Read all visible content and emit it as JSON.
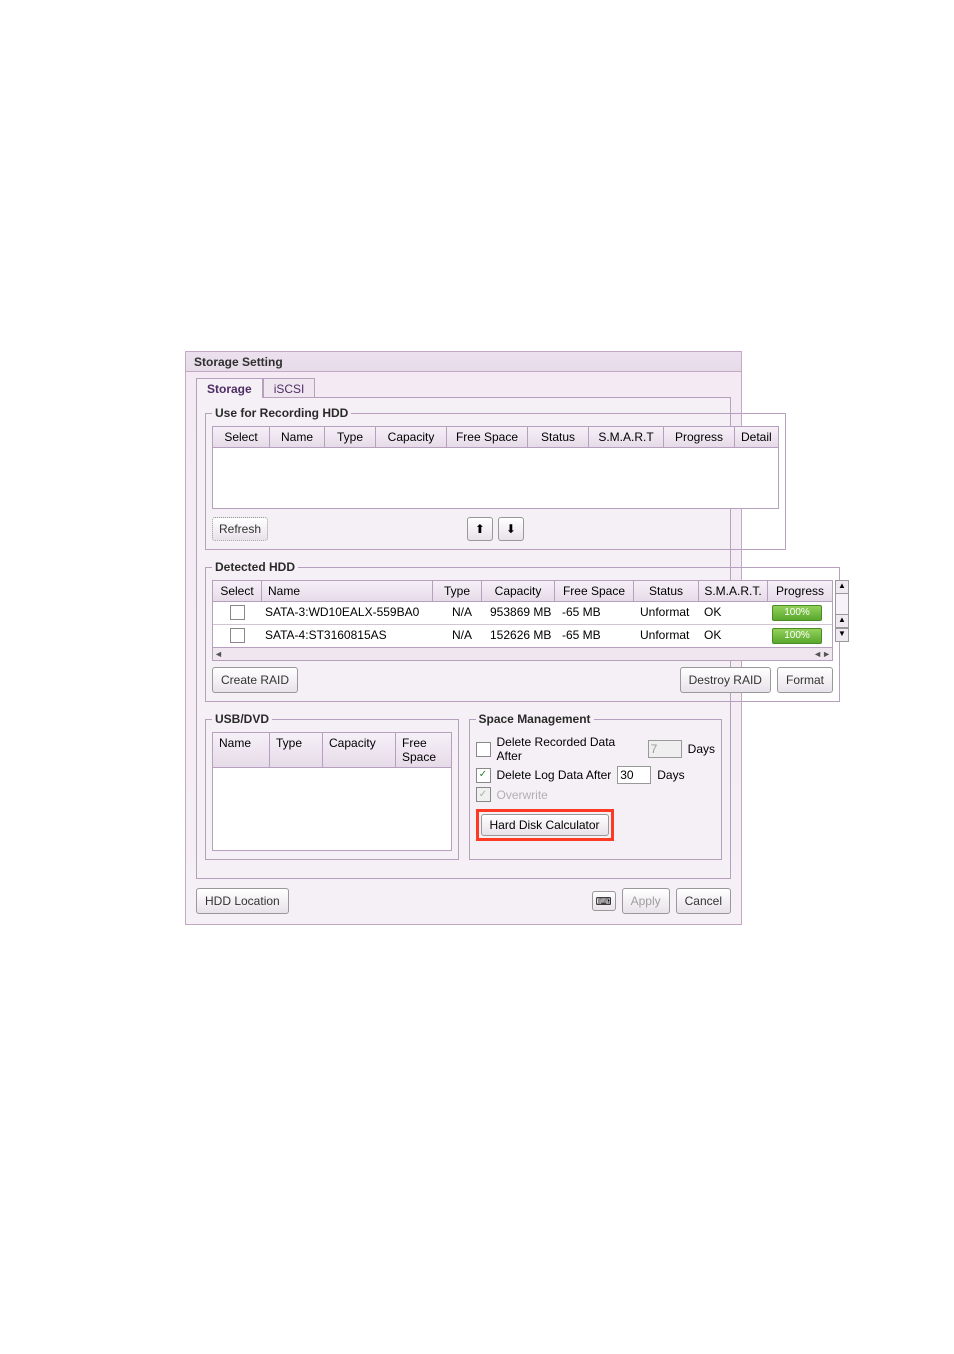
{
  "dialog": {
    "title": "Storage Setting",
    "tabs": {
      "storage": "Storage",
      "iscsi": "iSCSI",
      "active": 0
    }
  },
  "recording": {
    "legend": "Use for Recording HDD",
    "headers": [
      "Select",
      "Name",
      "Type",
      "Capacity",
      "Free Space",
      "Status",
      "S.M.A.R.T",
      "Progress",
      "Detail"
    ],
    "refresh": "Refresh"
  },
  "detected": {
    "legend": "Detected HDD",
    "headers": [
      "Select",
      "Name",
      "Type",
      "Capacity",
      "Free Space",
      "Status",
      "S.M.A.R.T.",
      "Progress"
    ],
    "rows": [
      {
        "name": "SATA-3:WD10EALX-559BA0",
        "type": "N/A",
        "capacity": "953869 MB",
        "free": "-65 MB",
        "status": "Unformat",
        "smart": "OK",
        "progress": "100%"
      },
      {
        "name": "SATA-4:ST3160815AS",
        "type": "N/A",
        "capacity": "152626 MB",
        "free": "-65 MB",
        "status": "Unformat",
        "smart": "OK",
        "progress": "100%"
      }
    ],
    "buttons": {
      "create": "Create RAID",
      "destroy": "Destroy RAID",
      "format": "Format"
    }
  },
  "usb": {
    "legend": "USB/DVD",
    "headers": [
      "Name",
      "Type",
      "Capacity",
      "Free Space"
    ]
  },
  "space": {
    "legend": "Space Management",
    "del_rec_label": "Delete Recorded Data After",
    "del_rec_value": "7",
    "del_rec_unit": "Days",
    "del_log_label": "Delete Log Data After",
    "del_log_value": "30",
    "del_log_unit": "Days",
    "overwrite": "Overwrite",
    "calc": "Hard Disk Calculator"
  },
  "bottom": {
    "hdd_location": "HDD Location",
    "apply": "Apply",
    "cancel": "Cancel"
  },
  "icons": {
    "up": "⬆",
    "down": "⬇",
    "left": "◄",
    "right": "►",
    "sup": "▲",
    "sdown": "▼"
  }
}
